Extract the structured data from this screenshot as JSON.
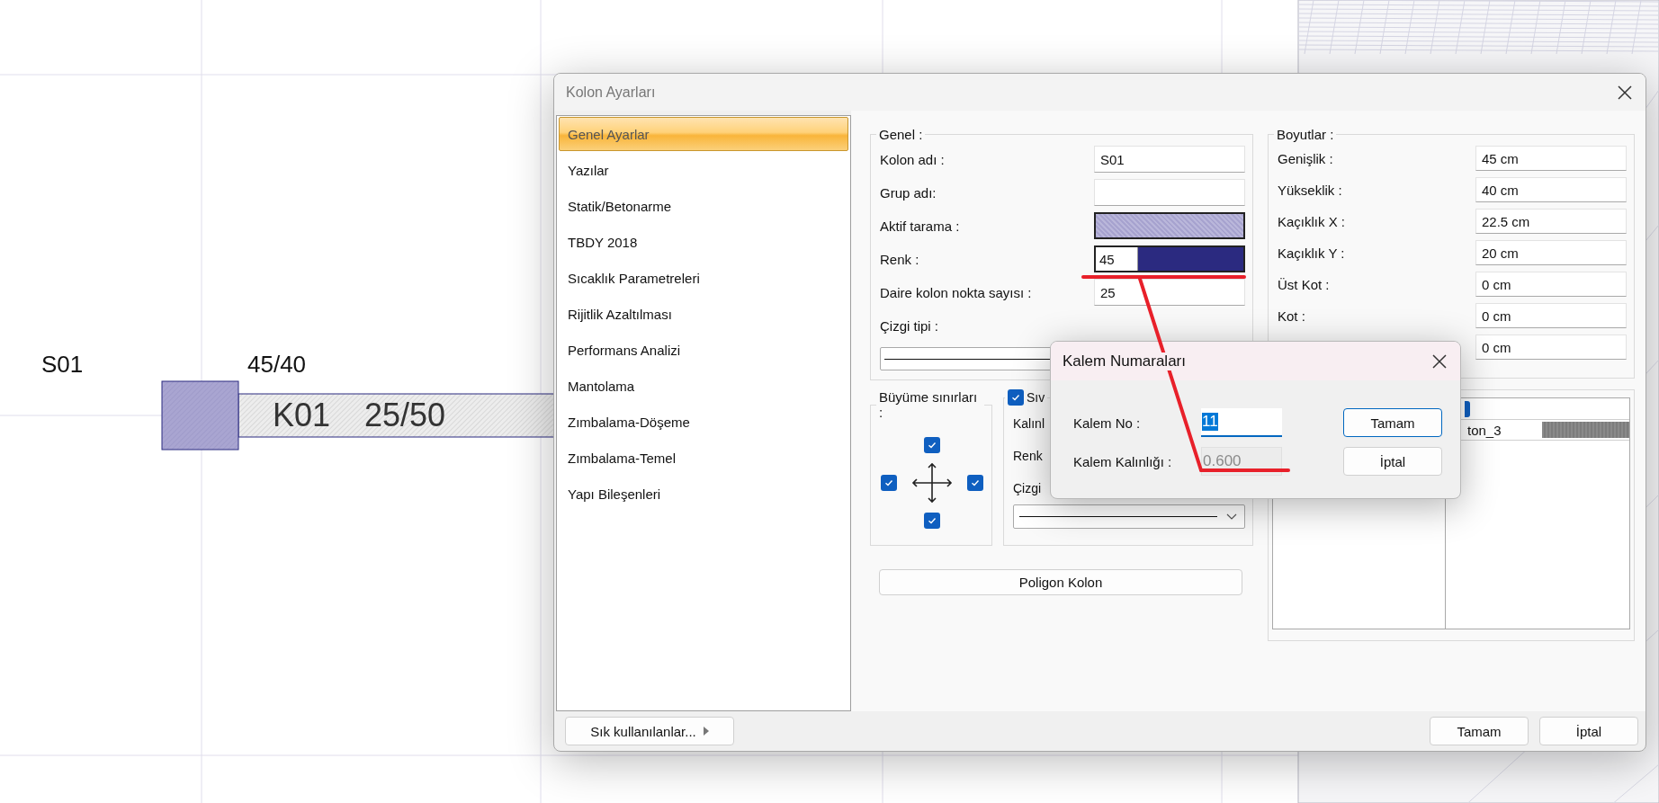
{
  "canvas": {
    "column_name": "S01",
    "column_size": "45/40",
    "beam_name": "K01",
    "beam_size": "25/50"
  },
  "dialog": {
    "title": "Kolon Ayarları",
    "nav": [
      {
        "label": "Genel Ayarlar",
        "selected": true
      },
      {
        "label": "Yazılar",
        "selected": false
      },
      {
        "label": "Statik/Betonarme",
        "selected": false
      },
      {
        "label": "TBDY 2018",
        "selected": false
      },
      {
        "label": "Sıcaklık Parametreleri",
        "selected": false
      },
      {
        "label": "Rijitlik Azaltılması",
        "selected": false
      },
      {
        "label": "Performans Analizi",
        "selected": false
      },
      {
        "label": "Mantolama",
        "selected": false
      },
      {
        "label": "Zımbalama-Döşeme",
        "selected": false
      },
      {
        "label": "Zımbalama-Temel",
        "selected": false
      },
      {
        "label": "Yapı Bileşenleri",
        "selected": false
      }
    ],
    "favorites_button": "Sık kullanılanlar...",
    "general": {
      "title": "Genel :",
      "fields": [
        {
          "kind": "text",
          "label": "Kolon adı :",
          "value": "S01"
        },
        {
          "kind": "text",
          "label": "Grup adı:"
        },
        {
          "kind": "hatch",
          "label": "Aktif tarama :"
        },
        {
          "kind": "pen",
          "label": "Renk :",
          "value": "45"
        },
        {
          "kind": "text",
          "label": "Daire kolon nokta sayısı :",
          "value": "25"
        },
        {
          "kind": "line",
          "label": "Çizgi tipi :"
        }
      ]
    },
    "growth": {
      "title": "Büyüme sınırları :",
      "top": {
        "checked": true
      },
      "left": {
        "checked": true
      },
      "right": {
        "checked": true
      },
      "bottom": {
        "checked": true
      }
    },
    "wall": {
      "checked": true,
      "title": "Sıv",
      "labels": [
        "Kalınl",
        "Renk",
        "Çizgi"
      ]
    },
    "polygon_button": "Poligon Kolon",
    "dimensions": {
      "title": "Boyutlar :",
      "fields": [
        {
          "label": "Genişlik :",
          "value": "45 cm"
        },
        {
          "label": "Yükseklik :",
          "value": "40 cm"
        },
        {
          "label": "Kaçıklık X :",
          "value": "22.5 cm"
        },
        {
          "label": "Kaçıklık Y :",
          "value": "20 cm"
        },
        {
          "label": "Üst Kot :",
          "value": "0 cm"
        },
        {
          "label": "Kot :",
          "value": "0 cm"
        },
        {
          "value": "0 cm"
        }
      ]
    },
    "materials": {
      "header_checked": true,
      "rows": [
        {
          "name": "ton_3"
        }
      ]
    },
    "buttons": [
      "Tamam",
      "İptal"
    ]
  },
  "pen_dialog": {
    "title": "Kalem Numaraları",
    "fields": [
      {
        "label": "Kalem No :",
        "value": "11",
        "highlighted": true,
        "disabled": false
      },
      {
        "label": "Kalem Kalınlığı :",
        "value": "0.600",
        "highlighted": false,
        "disabled": true
      }
    ],
    "buttons": [
      {
        "label": "Tamam",
        "default": true
      },
      {
        "label": "İptal",
        "default": false
      }
    ]
  }
}
